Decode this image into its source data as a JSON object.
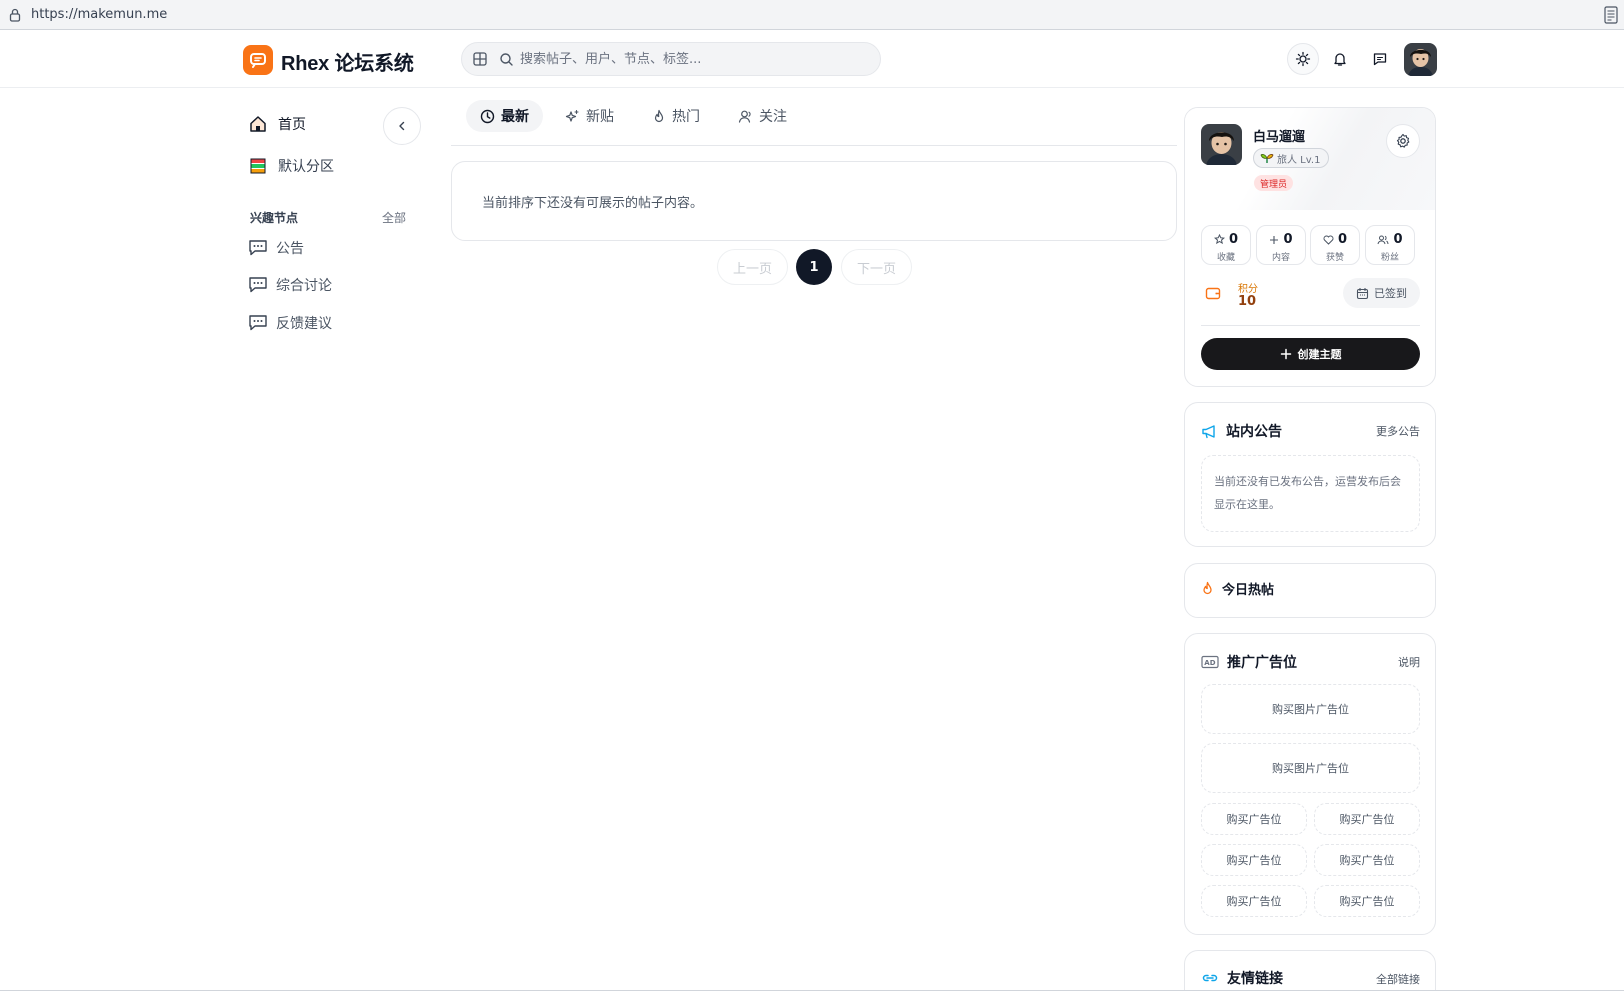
{
  "browser": {
    "url": "https://makemun.me"
  },
  "header": {
    "site_title": "Rhex 论坛系统",
    "search_placeholder": "搜索帖子、用户、节点、标签..."
  },
  "sidebar": {
    "home_label": "首页",
    "default_label": "默认分区",
    "interest_nodes_label": "兴趣节点",
    "all_label": "全部",
    "nodes": [
      {
        "label": "公告"
      },
      {
        "label": "综合讨论"
      },
      {
        "label": "反馈建议"
      }
    ]
  },
  "main": {
    "tabs": [
      {
        "label": "最新",
        "icon": "clock-icon",
        "active": true
      },
      {
        "label": "新贴",
        "icon": "sparkles-icon",
        "active": false
      },
      {
        "label": "热门",
        "icon": "flame-icon",
        "active": false
      },
      {
        "label": "关注",
        "icon": "user-icon",
        "active": false
      }
    ],
    "empty_text": "当前排序下还没有可展示的帖子内容。",
    "pagination": {
      "prev": "上一页",
      "current": "1",
      "next": "下一页"
    }
  },
  "user_card": {
    "name": "白马遛遛",
    "level": "旅人 Lv.1",
    "role": "管理员",
    "stats": [
      {
        "value": "0",
        "label": "收藏"
      },
      {
        "value": "0",
        "label": "内容"
      },
      {
        "value": "0",
        "label": "获赞"
      },
      {
        "value": "0",
        "label": "粉丝"
      }
    ],
    "points_label": "积分",
    "points_value": "10",
    "checkin_label": "已签到",
    "create_label": "创建主题"
  },
  "announcements": {
    "title": "站内公告",
    "more": "更多公告",
    "empty": "当前还没有已发布公告，运营发布后会显示在这里。"
  },
  "hot_today": {
    "title": "今日热帖"
  },
  "ads": {
    "title": "推广广告位",
    "explain": "说明",
    "image_slots": [
      "购买图片广告位",
      "购买图片广告位"
    ],
    "text_slots": [
      "购买广告位",
      "购买广告位",
      "购买广告位",
      "购买广告位",
      "购买广告位",
      "购买广告位"
    ]
  },
  "friend_links": {
    "title": "友情链接",
    "all": "全部链接"
  },
  "colors": {
    "brand": "#f97316",
    "dark": "#111827",
    "admin": "#dc2626",
    "points": "#d97706"
  }
}
